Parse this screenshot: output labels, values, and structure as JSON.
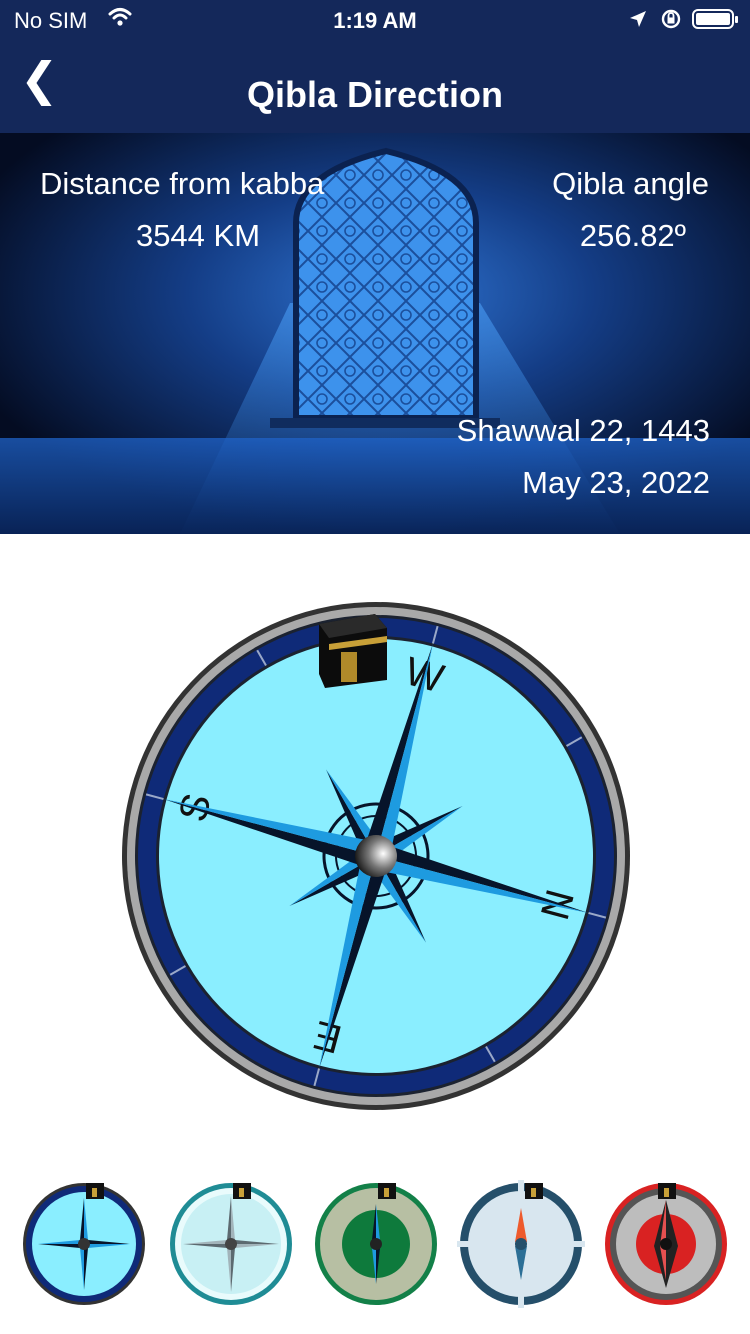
{
  "status_bar": {
    "carrier": "No SIM",
    "time": "1:19 AM"
  },
  "nav": {
    "back_icon": "chevron-left-icon",
    "back_glyph": "❮",
    "title": "Qibla Direction"
  },
  "info": {
    "distance_label": "Distance from kabba",
    "distance_value": "3544 KM",
    "angle_label": "Qibla angle",
    "angle_value": "256.82º",
    "hijri_date": "Shawwal 22, 1443",
    "gregorian_date": "May 23, 2022"
  },
  "compass": {
    "cardinals": {
      "n": "N",
      "e": "E",
      "s": "S",
      "w": "W"
    },
    "rotation_deg": 105,
    "colors": {
      "face": "#8aeeff",
      "ring": "#0f2a78",
      "star_blue": "#1e9be0",
      "star_dark": "#07142a"
    }
  },
  "theme_picker": {
    "themes": [
      {
        "name": "classic-blue",
        "face": "#8aeeff",
        "ring": "#0f2a78"
      },
      {
        "name": "silver-teal",
        "face": "#c8f0f4",
        "ring": "#1f8c95"
      },
      {
        "name": "green-ornate",
        "face": "#b7bfa3",
        "ring": "#138048"
      },
      {
        "name": "minimal-slate",
        "face": "#d8e6ef",
        "ring": "#254f6a"
      },
      {
        "name": "red-gloss",
        "face": "#bdbdbd",
        "ring": "#d92222"
      }
    ]
  }
}
